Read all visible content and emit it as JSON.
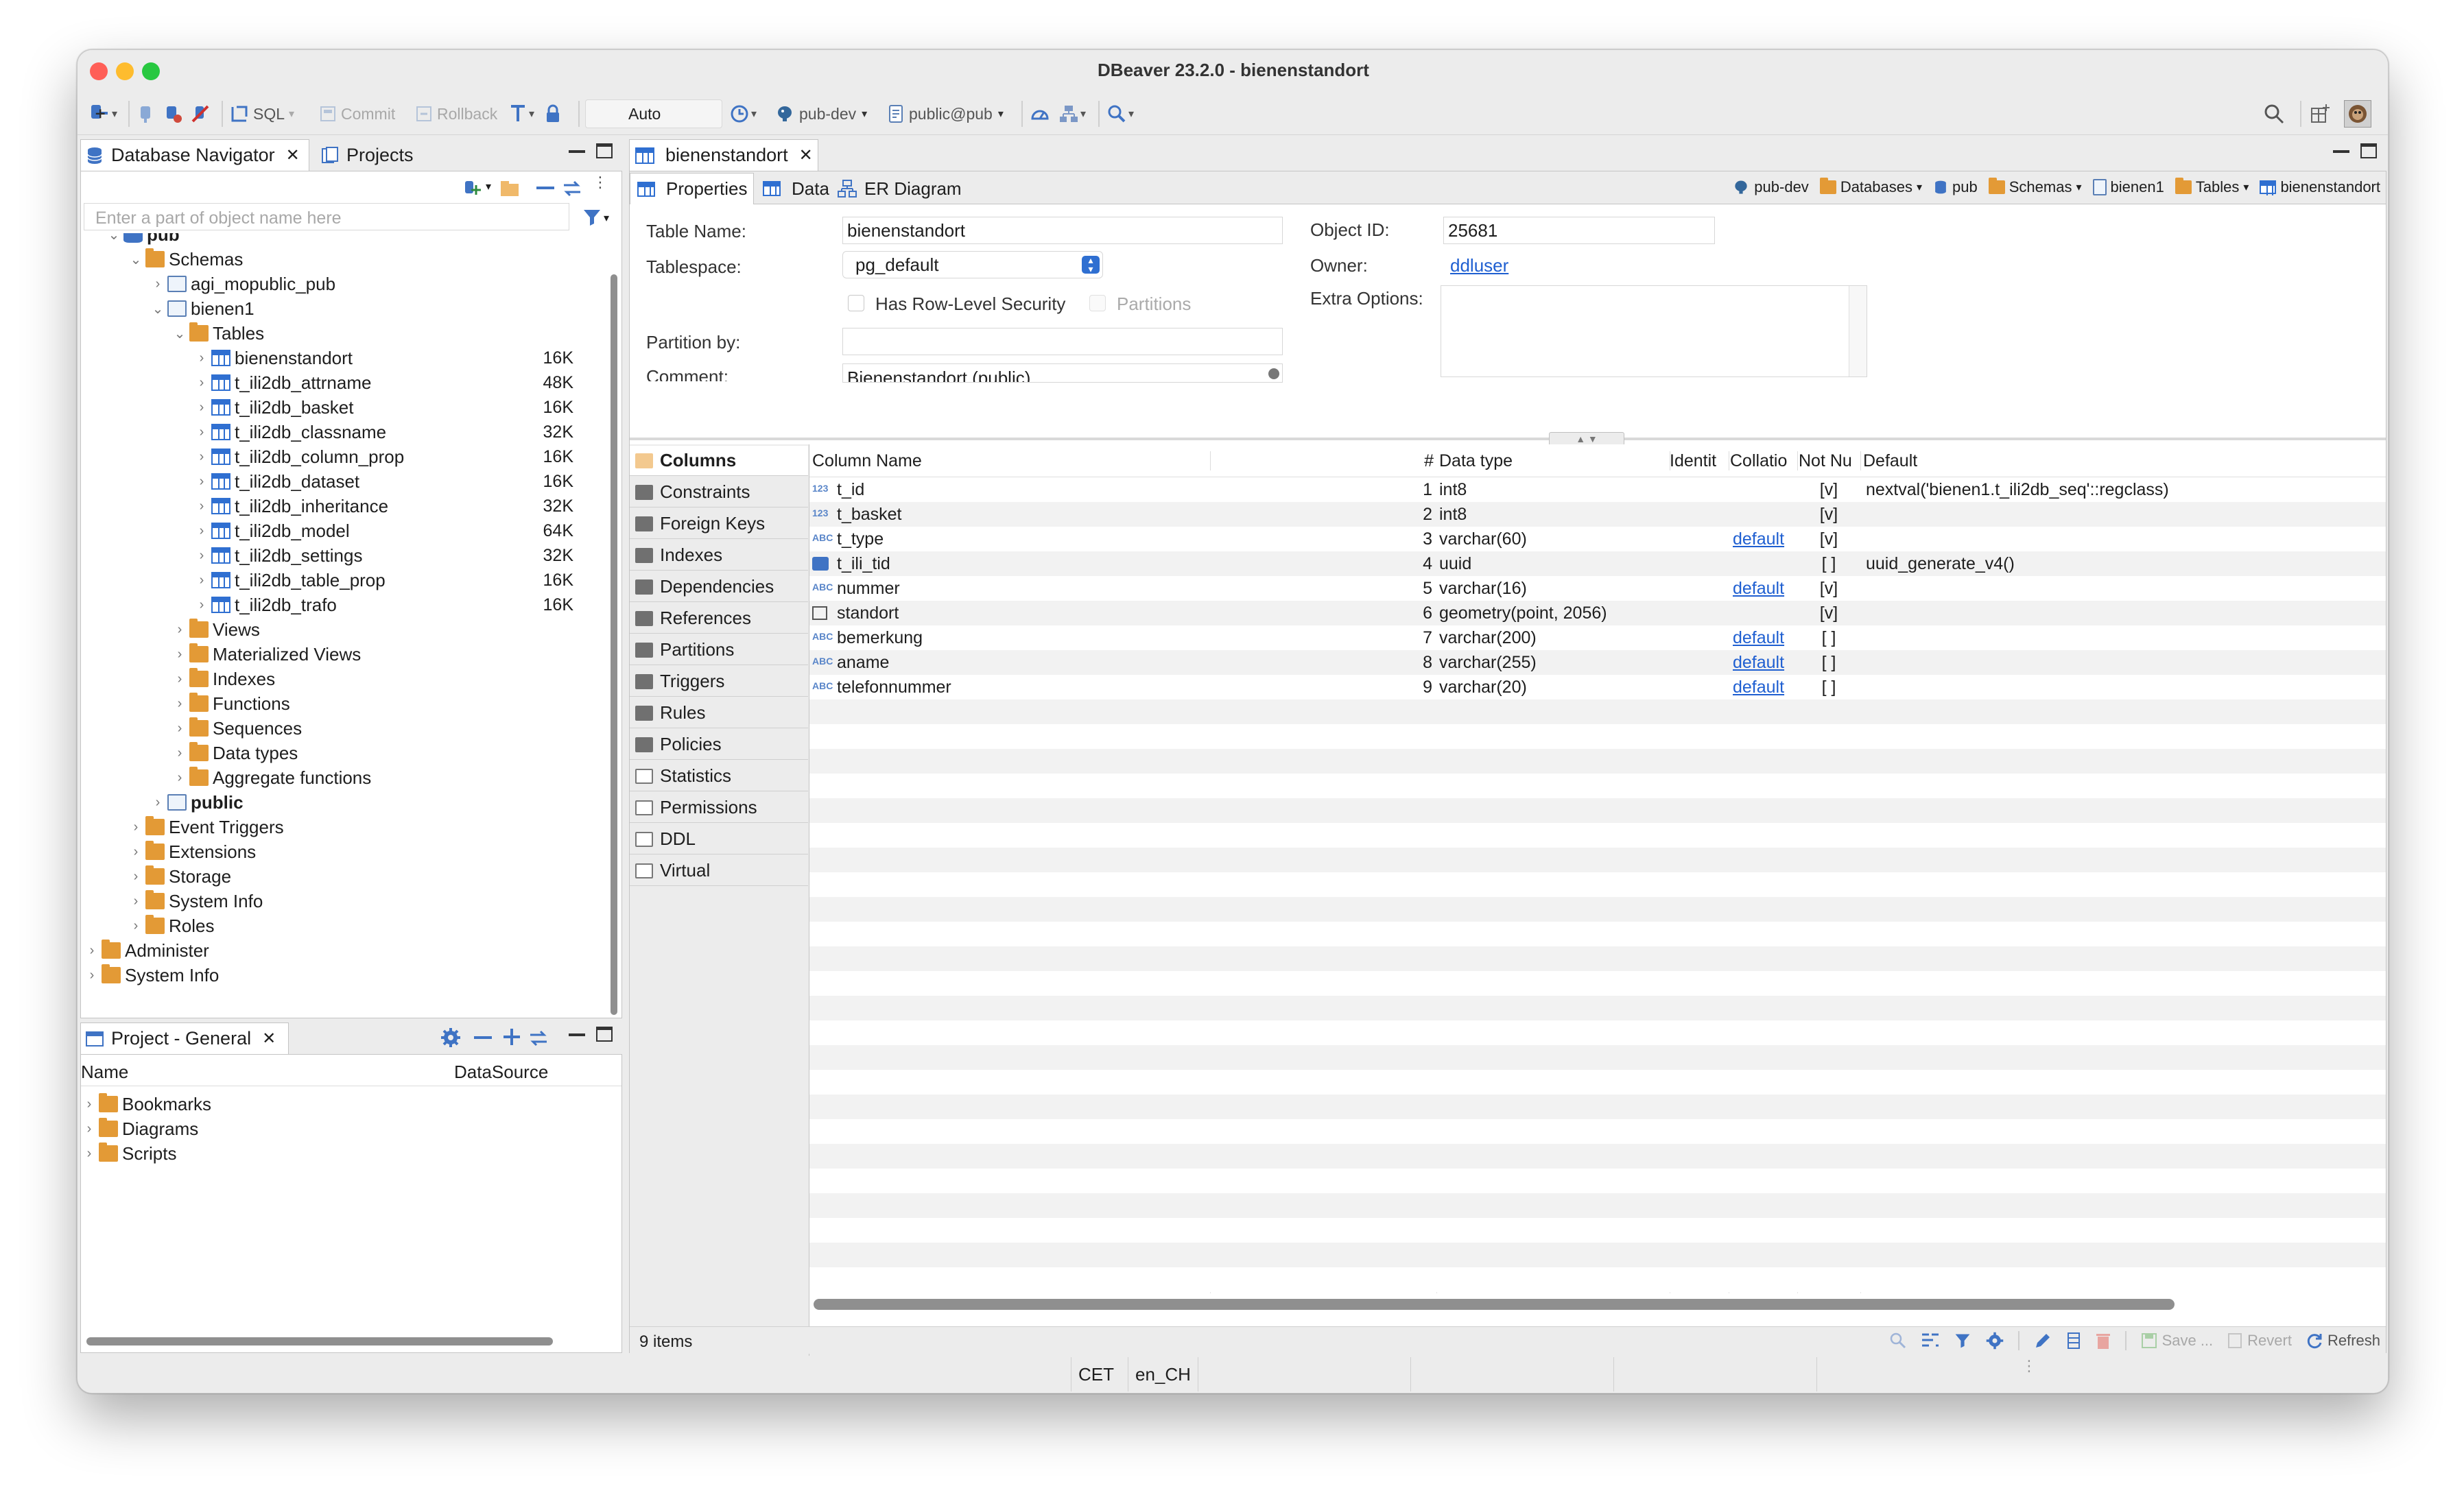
{
  "window": {
    "title": "DBeaver 23.2.0 - bienenstandort"
  },
  "toolbar": {
    "sql": "SQL",
    "commit": "Commit",
    "rollback": "Rollback",
    "auto": "Auto",
    "connection": "pub-dev",
    "schema": "public@pub"
  },
  "nav": {
    "tabs": [
      "Database Navigator",
      "Projects"
    ],
    "filter_placeholder": "Enter a part of object name here",
    "tree": [
      {
        "label": "pub",
        "depth": 2,
        "icon": "database-icon",
        "chev": "down",
        "bold": true
      },
      {
        "label": "Schemas",
        "depth": 3,
        "icon": "folder-icon",
        "chev": "down"
      },
      {
        "label": "agi_mopublic_pub",
        "depth": 4,
        "icon": "schema-icon",
        "chev": "right"
      },
      {
        "label": "bienen1",
        "depth": 4,
        "icon": "schema-icon",
        "chev": "down"
      },
      {
        "label": "Tables",
        "depth": 5,
        "icon": "folder-icon",
        "chev": "down"
      },
      {
        "label": "bienenstandort",
        "depth": 6,
        "icon": "table-icon",
        "chev": "right",
        "size": "16K"
      },
      {
        "label": "t_ili2db_attrname",
        "depth": 6,
        "icon": "table-icon",
        "chev": "right",
        "size": "48K"
      },
      {
        "label": "t_ili2db_basket",
        "depth": 6,
        "icon": "table-icon",
        "chev": "right",
        "size": "16K"
      },
      {
        "label": "t_ili2db_classname",
        "depth": 6,
        "icon": "table-icon",
        "chev": "right",
        "size": "32K"
      },
      {
        "label": "t_ili2db_column_prop",
        "depth": 6,
        "icon": "table-icon",
        "chev": "right",
        "size": "16K"
      },
      {
        "label": "t_ili2db_dataset",
        "depth": 6,
        "icon": "table-icon",
        "chev": "right",
        "size": "16K"
      },
      {
        "label": "t_ili2db_inheritance",
        "depth": 6,
        "icon": "table-icon",
        "chev": "right",
        "size": "32K"
      },
      {
        "label": "t_ili2db_model",
        "depth": 6,
        "icon": "table-icon",
        "chev": "right",
        "size": "64K"
      },
      {
        "label": "t_ili2db_settings",
        "depth": 6,
        "icon": "table-icon",
        "chev": "right",
        "size": "32K"
      },
      {
        "label": "t_ili2db_table_prop",
        "depth": 6,
        "icon": "table-icon",
        "chev": "right",
        "size": "16K"
      },
      {
        "label": "t_ili2db_trafo",
        "depth": 6,
        "icon": "table-icon",
        "chev": "right",
        "size": "16K"
      },
      {
        "label": "Views",
        "depth": 5,
        "icon": "folder-icon",
        "chev": "right"
      },
      {
        "label": "Materialized Views",
        "depth": 5,
        "icon": "folder-icon",
        "chev": "right"
      },
      {
        "label": "Indexes",
        "depth": 5,
        "icon": "folder-icon",
        "chev": "right"
      },
      {
        "label": "Functions",
        "depth": 5,
        "icon": "folder-icon",
        "chev": "right"
      },
      {
        "label": "Sequences",
        "depth": 5,
        "icon": "folder-icon",
        "chev": "right"
      },
      {
        "label": "Data types",
        "depth": 5,
        "icon": "folder-icon",
        "chev": "right"
      },
      {
        "label": "Aggregate functions",
        "depth": 5,
        "icon": "folder-icon",
        "chev": "right"
      },
      {
        "label": "public",
        "depth": 4,
        "icon": "schema-icon",
        "chev": "right",
        "bold": true
      },
      {
        "label": "Event Triggers",
        "depth": 3,
        "icon": "folder-icon",
        "chev": "right"
      },
      {
        "label": "Extensions",
        "depth": 3,
        "icon": "folder-icon",
        "chev": "right"
      },
      {
        "label": "Storage",
        "depth": 3,
        "icon": "folder-icon",
        "chev": "right"
      },
      {
        "label": "System Info",
        "depth": 3,
        "icon": "folder-icon",
        "chev": "right"
      },
      {
        "label": "Roles",
        "depth": 3,
        "icon": "folder-icon",
        "chev": "right"
      },
      {
        "label": "Administer",
        "depth": 1,
        "icon": "folder-icon",
        "chev": "right"
      },
      {
        "label": "System Info",
        "depth": 1,
        "icon": "folder-icon",
        "chev": "right"
      }
    ]
  },
  "project": {
    "tab": "Project - General",
    "col_name": "Name",
    "col_datasource": "DataSource",
    "items": [
      "Bookmarks",
      "Diagrams",
      "Scripts"
    ]
  },
  "editor": {
    "tab": "bienenstandort",
    "subtabs": [
      "Properties",
      "Data",
      "ER Diagram"
    ],
    "breadcrumbs": [
      "pub-dev",
      "Databases",
      "pub",
      "Schemas",
      "bienen1",
      "Tables",
      "bienenstandort"
    ],
    "props": {
      "table_name_label": "Table Name:",
      "table_name": "bienenstandort",
      "tablespace_label": "Tablespace:",
      "tablespace": "pg_default",
      "rls_label": "Has Row-Level Security",
      "partitions_label": "Partitions",
      "partition_by_label": "Partition by:",
      "comment_label": "Comment:",
      "comment": "Bienenstandort (public)",
      "object_id_label": "Object ID:",
      "object_id": "25681",
      "owner_label": "Owner:",
      "owner": "ddluser",
      "extra_label": "Extra Options:"
    },
    "sidetabs": [
      "Columns",
      "Constraints",
      "Foreign Keys",
      "Indexes",
      "Dependencies",
      "References",
      "Partitions",
      "Triggers",
      "Rules",
      "Policies",
      "Statistics",
      "Permissions",
      "DDL",
      "Virtual"
    ],
    "columns_header": [
      "Column Name",
      "#",
      "Data type",
      "Identit",
      "Collatio",
      "Not Nu",
      "Default"
    ],
    "columns": [
      {
        "icon": "123",
        "name": "t_id",
        "num": "1",
        "type": "int8",
        "collation": "",
        "notnull": "[v]",
        "default": "nextval('bienen1.t_ili2db_seq'::regclass)"
      },
      {
        "icon": "123",
        "name": "t_basket",
        "num": "2",
        "type": "int8",
        "collation": "",
        "notnull": "[v]",
        "default": ""
      },
      {
        "icon": "ABC",
        "name": "t_type",
        "num": "3",
        "type": "varchar(60)",
        "collation": "default",
        "notnull": "[v]",
        "default": ""
      },
      {
        "icon": "UID",
        "name": "t_ili_tid",
        "num": "4",
        "type": "uuid",
        "collation": "",
        "notnull": "[ ]",
        "default": "uuid_generate_v4()"
      },
      {
        "icon": "ABC",
        "name": "nummer",
        "num": "5",
        "type": "varchar(16)",
        "collation": "default",
        "notnull": "[v]",
        "default": ""
      },
      {
        "icon": "GEO",
        "name": "standort",
        "num": "6",
        "type": "geometry(point, 2056)",
        "collation": "",
        "notnull": "[v]",
        "default": ""
      },
      {
        "icon": "ABC",
        "name": "bemerkung",
        "num": "7",
        "type": "varchar(200)",
        "collation": "default",
        "notnull": "[ ]",
        "default": ""
      },
      {
        "icon": "ABC",
        "name": "aname",
        "num": "8",
        "type": "varchar(255)",
        "collation": "default",
        "notnull": "[ ]",
        "default": ""
      },
      {
        "icon": "ABC",
        "name": "telefonnummer",
        "num": "9",
        "type": "varchar(20)",
        "collation": "default",
        "notnull": "[ ]",
        "default": ""
      }
    ],
    "item_count": "9 items",
    "footer": {
      "save": "Save ...",
      "revert": "Revert",
      "refresh": "Refresh"
    }
  },
  "status": {
    "timezone": "CET",
    "locale": "en_CH"
  },
  "colors": {
    "accent": "#2f6fd1",
    "folder": "#e39a36",
    "link": "#1f5fd1",
    "close": "#ff5f57",
    "minimize": "#febc2e",
    "maximize": "#28c840"
  }
}
